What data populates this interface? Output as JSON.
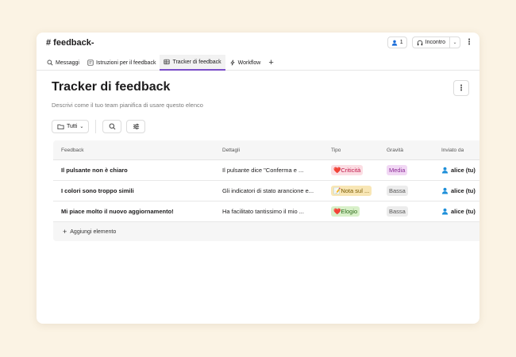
{
  "header": {
    "channel_title": "# feedback-",
    "members_count": "1",
    "huddle_label": "Incontro"
  },
  "tabs": [
    {
      "label": "Messaggi",
      "icon": "search-icon"
    },
    {
      "label": "Istruzioni per il feedback",
      "icon": "canvas-icon"
    },
    {
      "label": "Tracker di feedback",
      "icon": "list-icon",
      "active": true
    },
    {
      "label": "Workflow",
      "icon": "lightning-icon"
    }
  ],
  "page": {
    "title": "Tracker di feedback",
    "description": "Descrivi come il tuo team pianifica di usare questo elenco"
  },
  "toolbar": {
    "view_label": "Tutti"
  },
  "table": {
    "columns": [
      "Feedback",
      "Dettagli",
      "Tipo",
      "Gravità",
      "Inviato da"
    ],
    "rows": [
      {
        "feedback": "Il pulsante non è chiaro",
        "dettagli": "Il pulsante dice \"Conferma e ...",
        "tipo": "Criticità",
        "tipo_emoji": "❤️",
        "gravita": "Media",
        "inviato": "alice (tu)"
      },
      {
        "feedback": "I colori sono troppo simili",
        "dettagli": "Gli indicatori di stato arancione e...",
        "tipo": "Nota sul ...",
        "tipo_emoji": "📝",
        "gravita": "Bassa",
        "inviato": "alice (tu)"
      },
      {
        "feedback": "Mi piace molto il nuovo aggiornamento!",
        "dettagli": "Ha facilitato tantissimo il mio ...",
        "tipo": "Elogio",
        "tipo_emoji": "❤️",
        "gravita": "Bassa",
        "inviato": "alice (tu)"
      }
    ],
    "add_label": "Aggiungi elemento"
  },
  "colors": {
    "accent": "#7b4ec9",
    "background": "#fbf3e4"
  }
}
